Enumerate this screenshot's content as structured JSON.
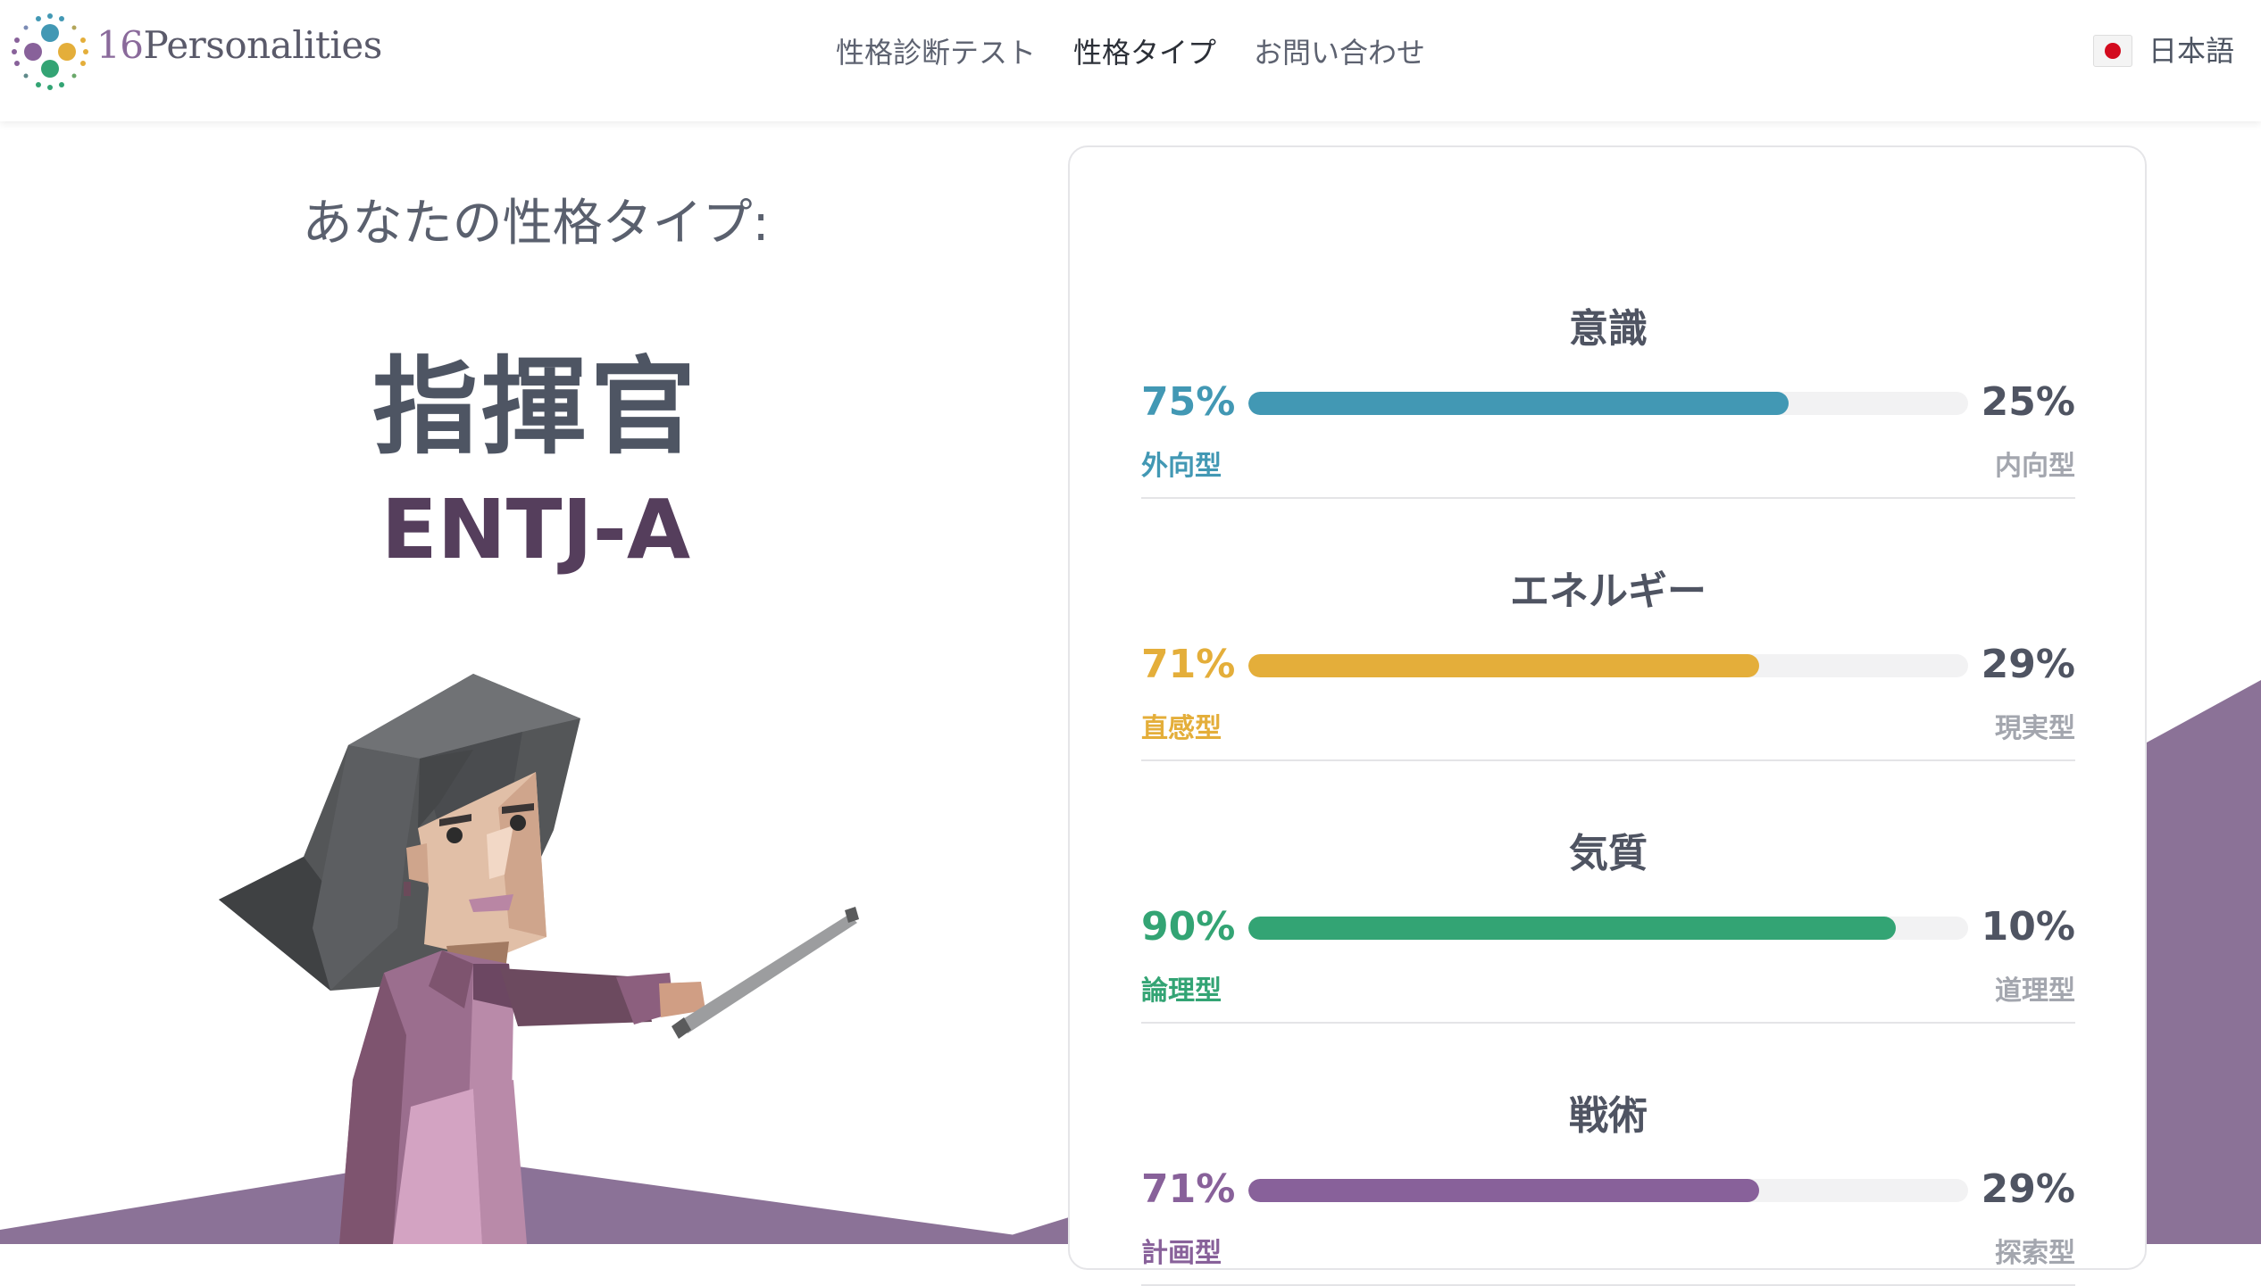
{
  "header": {
    "logo": {
      "number": "16",
      "word": "Personalities"
    },
    "nav": [
      {
        "label": "性格診断テスト",
        "active": false
      },
      {
        "label": "性格タイプ",
        "active": true
      },
      {
        "label": "お問い合わせ",
        "active": false
      }
    ],
    "language": {
      "label": "日本語",
      "icon": "japan-flag-icon"
    }
  },
  "result": {
    "intro": "あなたの性格タイプ:",
    "type_name": "指揮官",
    "type_code": "ENTJ-A",
    "illustration": "commander-character-illustration"
  },
  "traits": [
    {
      "title": "意識",
      "left_pct": "75%",
      "right_pct": "25%",
      "left_label": "外向型",
      "right_label": "内向型",
      "fill": 0.75,
      "color": "#4298b4"
    },
    {
      "title": "エネルギー",
      "left_pct": "71%",
      "right_pct": "29%",
      "left_label": "直感型",
      "right_label": "現実型",
      "fill": 0.71,
      "color": "#e4ae3a"
    },
    {
      "title": "気質",
      "left_pct": "90%",
      "right_pct": "10%",
      "left_label": "論理型",
      "right_label": "道理型",
      "fill": 0.9,
      "color": "#33a474"
    },
    {
      "title": "戦術",
      "left_pct": "71%",
      "right_pct": "29%",
      "left_label": "計画型",
      "right_label": "探索型",
      "fill": 0.71,
      "color": "#88619a"
    }
  ],
  "colors": {
    "analyst_purple": "#88619a",
    "background_purple": "#8a7296",
    "text_dark": "#4f5462",
    "text_muted": "#a3a6ae"
  }
}
